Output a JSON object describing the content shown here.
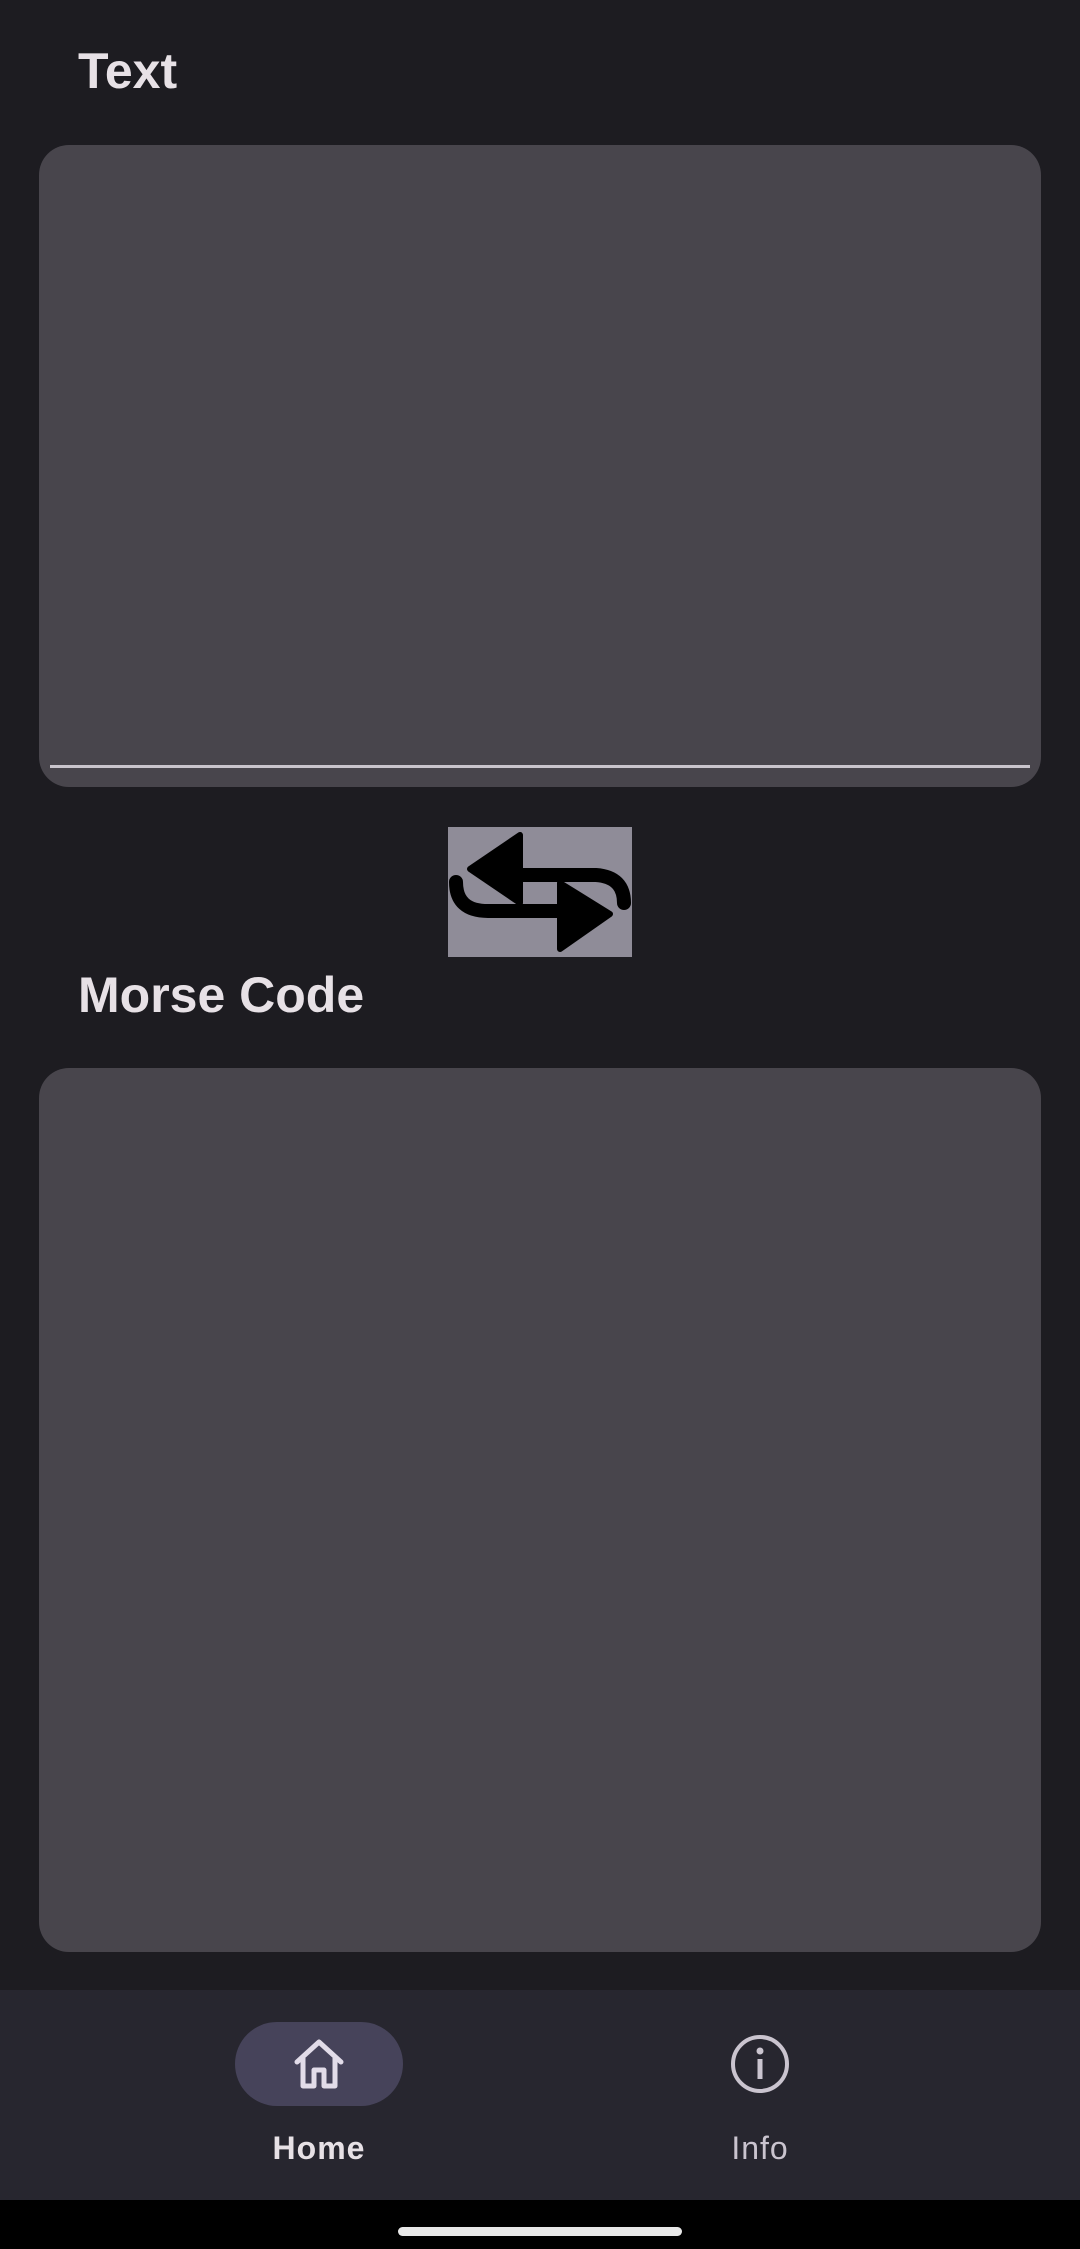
{
  "text_section": {
    "label": "Text",
    "value": ""
  },
  "morse_section": {
    "label": "Morse Code",
    "value": ""
  },
  "swap_button": {
    "icon": "swap-arrows-icon"
  },
  "nav": {
    "items": [
      {
        "label": "Home",
        "icon": "home-icon",
        "selected": true
      },
      {
        "label": "Info",
        "icon": "info-icon",
        "selected": false
      }
    ]
  },
  "colors": {
    "background": "#1d1c21",
    "field": "#48454c",
    "nav_background": "#27262f",
    "nav_active_pill": "#46435a",
    "swap_button": "#8f8c98"
  }
}
